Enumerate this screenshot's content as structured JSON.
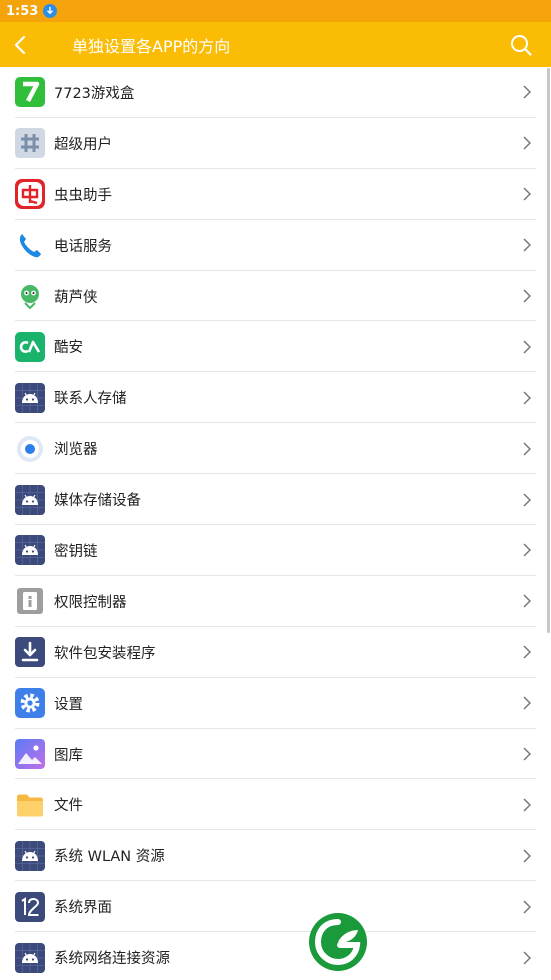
{
  "status": {
    "time": "1:53"
  },
  "header": {
    "title": "单独设置各APP的方向"
  },
  "icons": {
    "back": "back-arrow-icon",
    "search": "search-icon",
    "chevron": "chevron-right-icon"
  },
  "colors": {
    "status_bar": "#f4a40a",
    "app_bar": "#fbbc05",
    "android_tile": "#3b4a7a"
  },
  "apps": [
    {
      "label": "7723游戏盒",
      "icon": "7723-icon"
    },
    {
      "label": "超级用户",
      "icon": "superuser-icon"
    },
    {
      "label": "虫虫助手",
      "icon": "chongchong-icon"
    },
    {
      "label": "电话服务",
      "icon": "phone-icon"
    },
    {
      "label": "葫芦侠",
      "icon": "huluxia-icon"
    },
    {
      "label": "酷安",
      "icon": "coolapk-icon"
    },
    {
      "label": "联系人存储",
      "icon": "android-icon"
    },
    {
      "label": "浏览器",
      "icon": "browser-icon"
    },
    {
      "label": "媒体存储设备",
      "icon": "android-icon"
    },
    {
      "label": "密钥链",
      "icon": "android-icon"
    },
    {
      "label": "权限控制器",
      "icon": "permission-icon"
    },
    {
      "label": "软件包安装程序",
      "icon": "installer-icon"
    },
    {
      "label": "设置",
      "icon": "settings-icon"
    },
    {
      "label": "图库",
      "icon": "gallery-icon"
    },
    {
      "label": "文件",
      "icon": "folder-icon"
    },
    {
      "label": "系统 WLAN 资源",
      "icon": "android-icon"
    },
    {
      "label": "系统界面",
      "icon": "system-ui-icon"
    },
    {
      "label": "系统网络连接资源",
      "icon": "android-icon"
    }
  ]
}
